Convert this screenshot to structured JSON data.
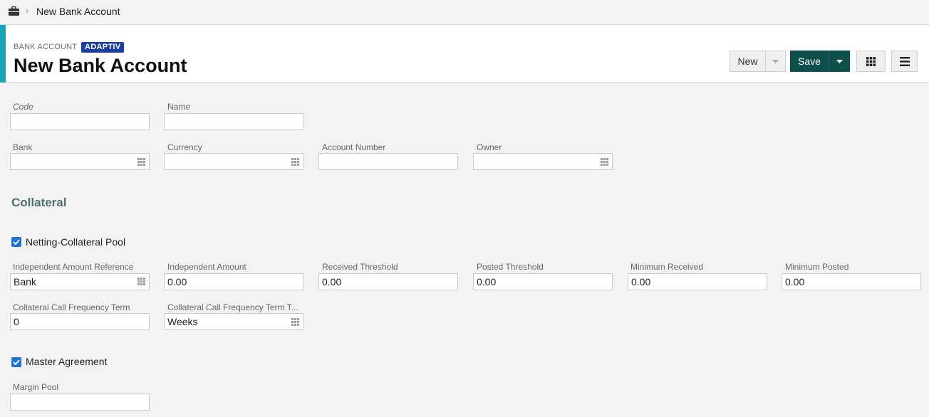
{
  "breadcrumb": {
    "separator": "›",
    "current": "New Bank Account"
  },
  "header": {
    "kicker": "BANK ACCOUNT",
    "badge": "ADAPTIV",
    "title": "New Bank Account",
    "new_label": "New",
    "save_label": "Save"
  },
  "colors": {
    "accent": "#16a3b8",
    "save": "#0d4f4b",
    "badge": "#1b3fa0",
    "section": "#4f6f70",
    "checkbox": "#1f74d1"
  },
  "fields": {
    "code": {
      "label": "Code",
      "value": ""
    },
    "name": {
      "label": "Name",
      "value": ""
    },
    "bank": {
      "label": "Bank",
      "value": ""
    },
    "currency": {
      "label": "Currency",
      "value": ""
    },
    "account_number": {
      "label": "Account Number",
      "value": ""
    },
    "owner": {
      "label": "Owner",
      "value": ""
    }
  },
  "collateral": {
    "title": "Collateral",
    "netting_pool": {
      "label": "Netting-Collateral Pool",
      "checked": true
    },
    "independent_amount_reference": {
      "label": "Independent Amount Reference",
      "value": "Bank"
    },
    "independent_amount": {
      "label": "Independent Amount",
      "value": "0.00"
    },
    "received_threshold": {
      "label": "Received Threshold",
      "value": "0.00"
    },
    "posted_threshold": {
      "label": "Posted Threshold",
      "value": "0.00"
    },
    "minimum_received": {
      "label": "Minimum Received",
      "value": "0.00"
    },
    "minimum_posted": {
      "label": "Minimum Posted",
      "value": "0.00"
    },
    "call_frequency_term": {
      "label": "Collateral Call Frequency Term",
      "value": "0"
    },
    "call_frequency_term_type": {
      "label": "Collateral Call Frequency Term T...",
      "value": "Weeks"
    },
    "master_agreement": {
      "label": "Master Agreement",
      "checked": true
    },
    "margin_pool": {
      "label": "Margin Pool",
      "value": ""
    }
  }
}
